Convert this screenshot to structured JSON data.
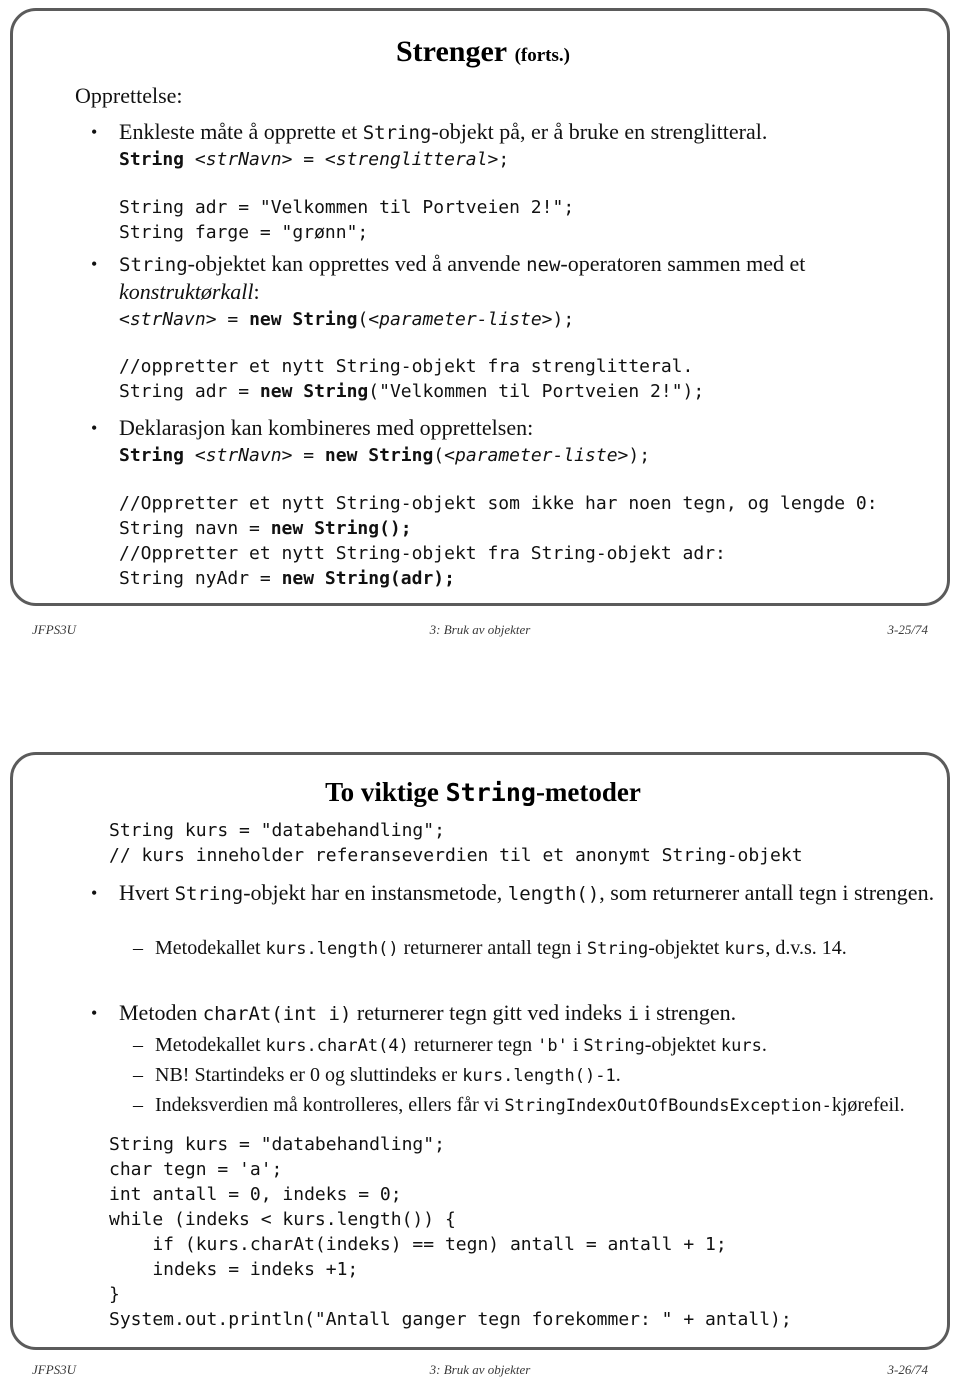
{
  "document": {
    "type": "lecture-slides",
    "language": "no"
  },
  "slide1": {
    "title_main": "Strenger",
    "title_sub": "(forts.)",
    "lead": "Opprettelse:",
    "bullet1": {
      "marker": "•",
      "text_before": "Enkleste måte å opprette et ",
      "code_inline": "String",
      "text_after": "-objekt på, er å bruke en strenglitteral.",
      "syntax_bold1": "String",
      "syntax_italic1": " <strNavn>",
      "syntax_plain1": " = ",
      "syntax_italic2": "<strenglitteral>",
      "syntax_plain2": ";"
    },
    "code_block1": [
      "String adr = \"Velkommen til Portveien 2!\";",
      "String farge = \"grønn\";"
    ],
    "bullet2": {
      "marker": "•",
      "line1_before": "",
      "line1_code": "String",
      "line1_mid": "-objektet kan opprettes ved å anvende ",
      "line1_code2": "new",
      "line1_after": "-operatoren sammen med et",
      "line2_italic": "konstruktørkall",
      "line2_colon": ":",
      "syntax_italic1": "<strNavn>",
      "syntax_plain1": " = ",
      "syntax_bold1": "new String",
      "syntax_plain2": "(",
      "syntax_italic2": "<parameter-liste>",
      "syntax_plain3": ");"
    },
    "code_block2": {
      "comment": "//oppretter et nytt String-objekt fra strenglitteral.",
      "line_plain1": "String adr = ",
      "line_bold1": "new String",
      "line_plain2": "(\"Velkommen til Portveien 2!\");"
    },
    "bullet3": {
      "marker": "•",
      "text": "Deklarasjon kan kombineres med opprettelsen:",
      "syntax_bold1": "String",
      "syntax_italic1": " <strNavn>",
      "syntax_plain1": " = ",
      "syntax_bold2": "new String",
      "syntax_plain2": "(",
      "syntax_italic2": "<parameter-liste>",
      "syntax_plain3": ");"
    },
    "code_block3": [
      "//Oppretter et nytt String-objekt som ikke har noen tegn, og lengde 0:",
      "String navn = new String();",
      "//Oppretter et nytt String-objekt fra String-objekt adr:",
      "String nyAdr = new String(adr);"
    ],
    "code_block3_bold_parts": [
      "new String();",
      "new String(adr);"
    ],
    "footer": {
      "left": "JFPS3U",
      "center": "3: Bruk av objekter",
      "right": "3-25/74"
    }
  },
  "slide2": {
    "title_before": "To viktige ",
    "title_code": "String",
    "title_after": "-metoder",
    "code_block1": [
      "String kurs = \"databehandling\";",
      "// kurs inneholder referanseverdien til et anonymt String-objekt"
    ],
    "bullet1": {
      "marker": "•",
      "p1": "Hvert ",
      "c1": "String",
      "p2": "-objekt har en instansmetode, ",
      "c2": "length()",
      "p3": ", som returnerer antall tegn i",
      "p4": "strengen."
    },
    "sub1": {
      "marker": "–",
      "p1": "Metodekallet ",
      "c1": "kurs.length()",
      "p2": " returnerer antall tegn i ",
      "c2": "String",
      "p3": "-objektet ",
      "c3": "kurs",
      "p4": ", d.v.s.",
      "p5": "14."
    },
    "bullet2": {
      "marker": "•",
      "p1": "Metoden ",
      "c1": "charAt(int i)",
      "p2": " returnerer tegn gitt ved indeks ",
      "c2": "i",
      "p3": " i strengen."
    },
    "sub2": {
      "marker": "–",
      "p1": "Metodekallet ",
      "c1": "kurs.charAt(4)",
      "p2": " returnerer tegn ",
      "c2": "'b'",
      "p3": " i ",
      "c3": "String",
      "p4": "-objektet ",
      "c4": "kurs",
      "p5": "."
    },
    "sub3": {
      "marker": "–",
      "p1": "NB! Startindeks er 0 og sluttindeks er ",
      "c1": "kurs.length()-1",
      "p2": "."
    },
    "sub4": {
      "marker": "–",
      "p1": "Indeksverdien må kontrolleres, ellers får vi ",
      "c1": "StringIndexOutOfBoundsException-",
      "p2": "kjørefeil."
    },
    "code_block2": [
      "String kurs = \"databehandling\";",
      "char tegn = 'a';",
      "int antall = 0, indeks = 0;",
      "while (indeks < kurs.length()) {",
      "    if (kurs.charAt(indeks) == tegn) antall = antall + 1;",
      "    indeks = indeks +1;",
      "}",
      "System.out.println(\"Antall ganger tegn forekommer: \" + antall);"
    ],
    "footer": {
      "left": "JFPS3U",
      "center": "3: Bruk av objekter",
      "right": "3-26/74"
    }
  },
  "colors": {
    "frame_border": "#5b5b5b",
    "text": "#111111",
    "footer_text": "#3a3a3a",
    "background": "#ffffff"
  }
}
